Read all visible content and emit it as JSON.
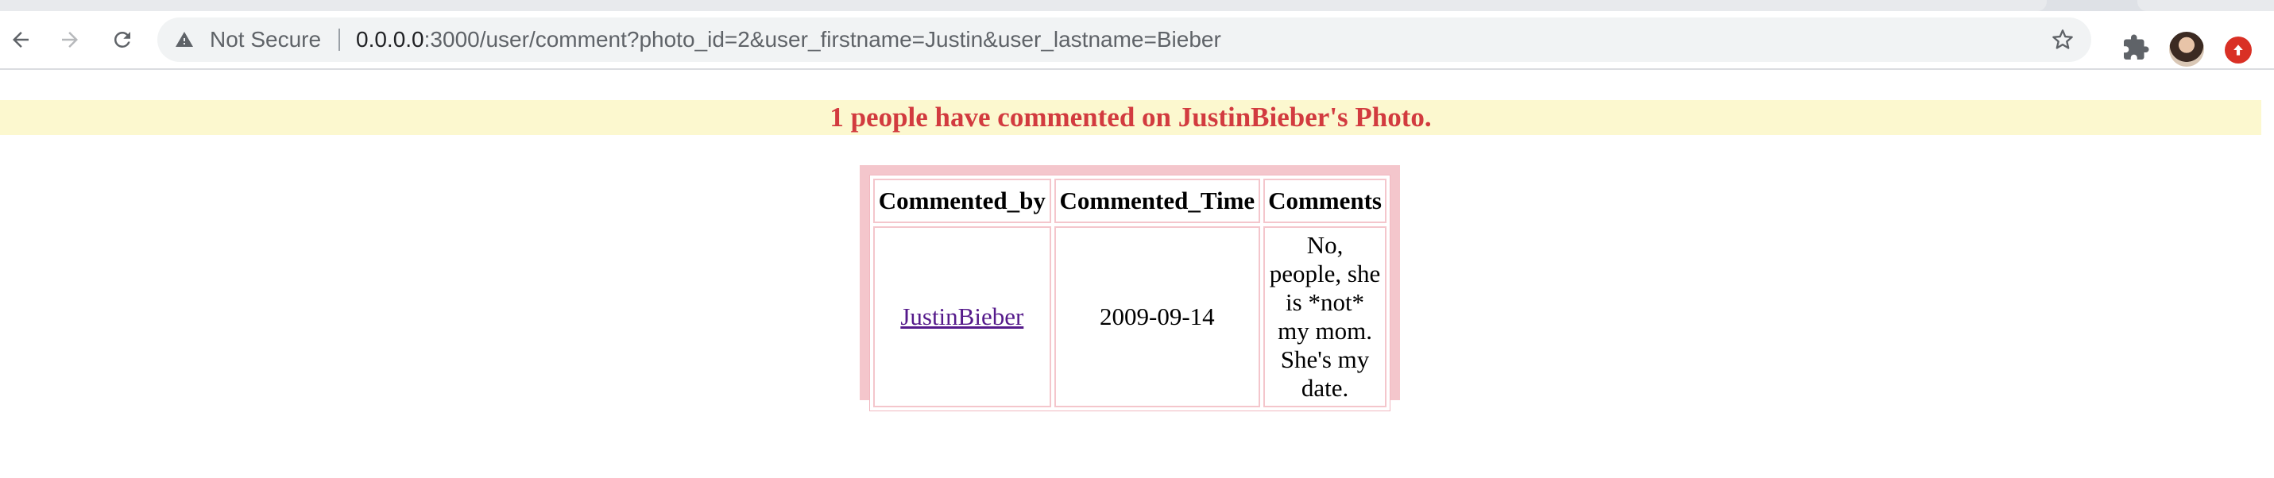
{
  "browser": {
    "security_label": "Not Secure",
    "url_host": "0.0.0.0",
    "url_rest": ":3000/user/comment?photo_id=2&user_firstname=Justin&user_lastname=Bieber",
    "icons": [
      "back-icon",
      "forward-icon",
      "reload-icon",
      "warning-icon",
      "star-icon",
      "puzzle-icon",
      "avatar",
      "update-icon"
    ]
  },
  "banner": {
    "heading": "1 people have commented on JustinBieber's Photo.",
    "heading_color": "#d23b3f",
    "background": "#fcf8cf"
  },
  "comments_table": {
    "border_color": "#f4c6cc",
    "headers": [
      "Commented_by",
      "Commented_Time",
      "Comments"
    ],
    "rows": [
      {
        "commented_by": "JustinBieber",
        "commented_time": "2009-09-14",
        "comment": "No, people, she is *not* my mom. She's my date."
      }
    ]
  }
}
